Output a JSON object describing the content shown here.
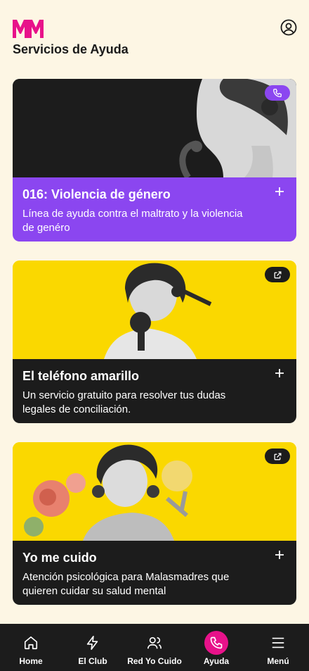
{
  "header": {
    "logo_text": "MM",
    "title": "Servicios de Ayuda",
    "profile_icon": "user-circle-icon"
  },
  "cards": [
    {
      "title": "016: Violencia de género",
      "description": "Línea de ayuda contra el maltrato y la violencia de genéro",
      "badge_icon": "phone-icon",
      "action_icon": "plus-icon",
      "image": "woman-with-headphones-photo",
      "colors": {
        "image_bg": "#1c1c1c",
        "body_bg": "#8b46f0",
        "badge_bg": "#8b46f0"
      }
    },
    {
      "title": "El teléfono amarillo",
      "description": "Un servicio gratuito para resolver tus dudas legales de conciliación.",
      "badge_icon": "external-link-icon",
      "action_icon": "plus-icon",
      "image": "woman-on-vintage-phone-photo",
      "colors": {
        "image_bg": "#fad800",
        "body_bg": "#1c1c1c",
        "badge_bg": "#1c1c1c"
      }
    },
    {
      "title": "Yo me cuido",
      "description": "Atención psicológica para Malasmadres que quieren cuidar su salud mental",
      "badge_icon": "external-link-icon",
      "action_icon": "plus-icon",
      "image": "woman-with-roses-photo",
      "colors": {
        "image_bg": "#fad800",
        "body_bg": "#1c1c1c",
        "badge_bg": "#1c1c1c"
      }
    }
  ],
  "nav": {
    "items": [
      {
        "label": "Home",
        "icon": "home-icon",
        "active": false
      },
      {
        "label": "El Club",
        "icon": "lightning-icon",
        "active": false
      },
      {
        "label": "Red Yo Cuido",
        "icon": "users-icon",
        "active": false
      },
      {
        "label": "Ayuda",
        "icon": "phone-icon",
        "active": true
      },
      {
        "label": "Menú",
        "icon": "hamburger-menu-icon",
        "active": false
      }
    ],
    "colors": {
      "background": "#1c1c1c",
      "active": "#e8128a"
    }
  },
  "colors": {
    "page_bg": "#fdf6e4",
    "brand_pink": "#e8128a"
  }
}
